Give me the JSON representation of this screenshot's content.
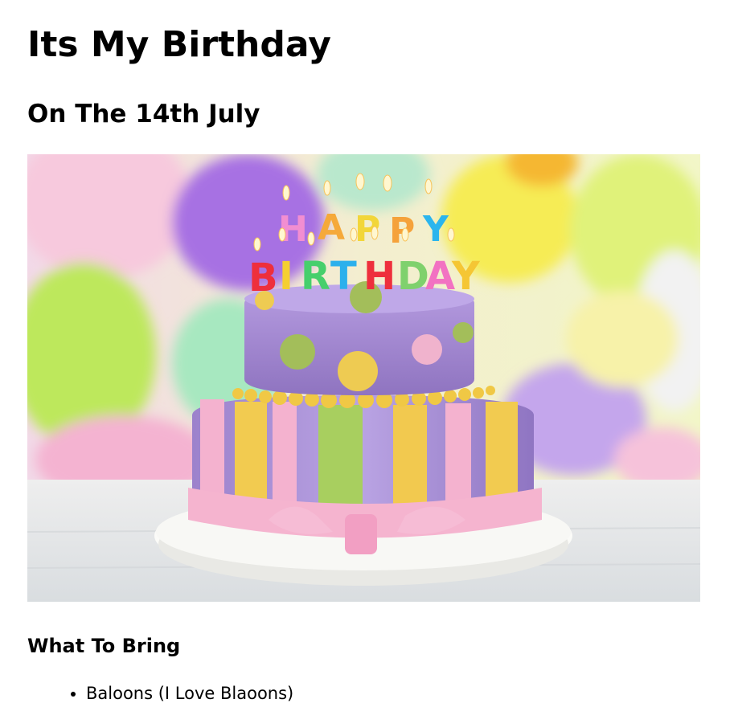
{
  "page": {
    "title": "Its My Birthday",
    "subtitle": "On The 14th July"
  },
  "hero_image": {
    "candle_letters": [
      "H",
      "A",
      "P",
      "P",
      "Y",
      "B",
      "I",
      "R",
      "T",
      "H",
      "D",
      "A",
      "Y"
    ]
  },
  "bring": {
    "heading": "What To Bring",
    "items": [
      "Baloons (I Love Blaoons)"
    ]
  },
  "colors": {
    "cake_purple": "#a88fd0",
    "cake_pink": "#f2a9c8",
    "cake_yellow": "#f1cf55",
    "cake_green": "#a7cf5e",
    "board_white": "#f5f5f2"
  }
}
